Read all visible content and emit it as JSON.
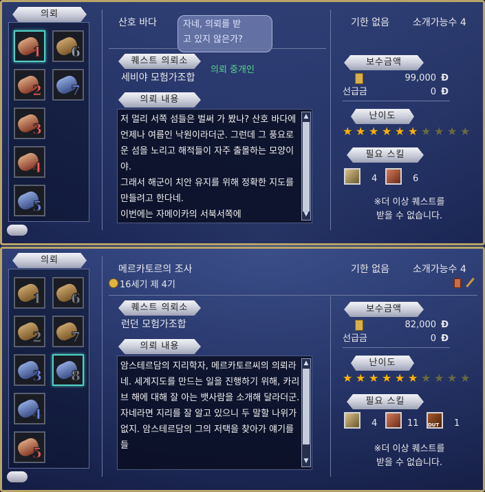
{
  "panels": [
    {
      "sidebar_title": "의뢰",
      "quest_name": "산호 바다",
      "deadline": "기한 없음",
      "referral_count": "소개가능수 4",
      "bubble_text": "자네, 의뢰를 받\n고 있지 않은가?",
      "npc_label": "의뢰 중개인",
      "office_label": "퀘스트 의뢰소",
      "office_name": "세비야 모험가조합",
      "content_label": "의뢰 내용",
      "content_text": "저 멀리 서쪽 섬들은 벌써 가 봤나? 산호 바다에 언제나 여름인 낙원이라더군. 그런데 그 풍요로운 섬을 노리고 해적들이 자주 출몰하는 모양이야.\n그래서 해군이 치안 유지를 위해 정확한 지도를 만들려고 한다네.\n이번에는 자메이카의 서북서쪽에",
      "reward_label": "보수금액",
      "reward_value": "99,000",
      "advance_label": "선급금",
      "advance_value": "0",
      "currency": "Đ",
      "difficulty_label": "난이도",
      "difficulty": 6,
      "difficulty_max": 10,
      "skills_label": "필요 스킬",
      "skills": [
        {
          "icon": "telescope-skill-icon",
          "value": "4"
        },
        {
          "icon": "surveying-skill-icon",
          "value": "6"
        }
      ],
      "notice": "※더 이상 퀘스트를\n받을 수 없습니다.",
      "slots": [
        {
          "num": "1",
          "color": "red",
          "selected": true
        },
        {
          "num": "6",
          "color": "gray2",
          "selected": false
        },
        {
          "num": "2",
          "color": "red",
          "selected": false
        },
        {
          "num": "7",
          "color": "blue",
          "selected": false
        },
        {
          "num": "3",
          "color": "red",
          "selected": false
        },
        {
          "num": "4",
          "color": "red",
          "selected": false
        },
        {
          "num": "5",
          "color": "blue",
          "selected": false
        }
      ]
    },
    {
      "sidebar_title": "의뢰",
      "quest_name": "메르카토르의 조사",
      "deadline": "기한 없음",
      "referral_count": "소개가능수 4",
      "era": "16세기 제 4기",
      "office_label": "퀘스트 의뢰소",
      "office_name": "런던 모험가조합",
      "content_label": "의뢰 내용",
      "content_text": "암스테르담의 지리학자, 메르카토르씨의 의뢰라네. 세계지도를 만드는 일을 진행하기 위해, 카리브 해에 대해 잘 아는 뱃사람을 소개해 달라더군.\n자네라면 지리를 잘 알고 있으니 두 말할 나위가 없지. 암스테르담의 그의 저택을 찾아가 얘기를 들",
      "reward_label": "보수금액",
      "reward_value": "82,000",
      "advance_label": "선급금",
      "advance_value": "0",
      "currency": "Đ",
      "difficulty_label": "난이도",
      "difficulty": 6,
      "difficulty_max": 10,
      "skills_label": "필요 스킬",
      "skills": [
        {
          "icon": "telescope-skill-icon",
          "value": "4"
        },
        {
          "icon": "surveying-skill-icon",
          "value": "11"
        },
        {
          "icon": "book-skill-icon",
          "value": "1",
          "badge": "DUT"
        }
      ],
      "notice": "※더 이상 퀘스트를\n받을 수 없습니다.",
      "slots": [
        {
          "num": "1",
          "color": "gray",
          "selected": false
        },
        {
          "num": "6",
          "color": "gray",
          "selected": false
        },
        {
          "num": "2",
          "color": "gray",
          "selected": false
        },
        {
          "num": "7",
          "color": "gray",
          "selected": false
        },
        {
          "num": "3",
          "color": "blue",
          "selected": false
        },
        {
          "num": "8",
          "color": "gray",
          "selected": true
        },
        {
          "num": "4",
          "color": "blue",
          "selected": false
        },
        {
          "num": "5",
          "color": "red",
          "selected": false
        }
      ]
    }
  ]
}
